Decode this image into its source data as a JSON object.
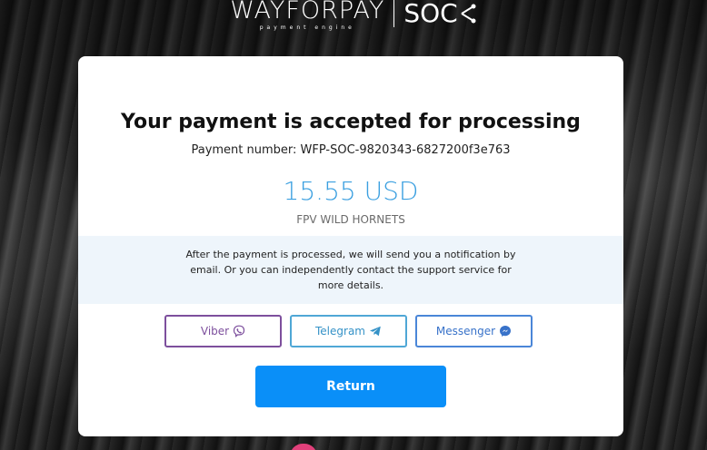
{
  "header": {
    "logo_main": "WAYFORPAY",
    "logo_sub": "payment engine",
    "logo_soc": "SOC"
  },
  "card": {
    "title": "Your payment is accepted for processing",
    "payment_number": "Payment number: WFP-SOC-9820343-6827200f3e763",
    "amount": "15.55 USD",
    "merchant": "FPV WILD HORNETS",
    "info_text": "After the payment is processed, we will send you a notification by email. Or you can independently contact the support service for more details.",
    "contacts": [
      {
        "label": "Viber",
        "icon": "viber-icon",
        "color": "#7d4f9d"
      },
      {
        "label": "Telegram",
        "icon": "telegram-icon",
        "color": "#4fa7d6"
      },
      {
        "label": "Messenger",
        "icon": "messenger-icon",
        "color": "#4a86d8"
      }
    ],
    "return_label": "Return"
  },
  "colors": {
    "accent": "#0a8ff8",
    "amount": "#3a9fe0",
    "info_bg": "#eef5fb"
  }
}
